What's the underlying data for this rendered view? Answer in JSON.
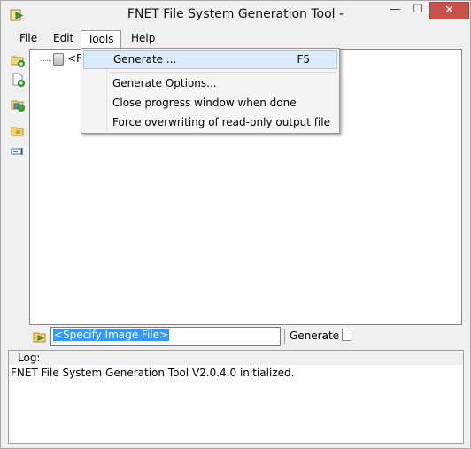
{
  "window": {
    "title": "FNET File System Generation Tool -",
    "minimize_glyph": "—",
    "maximize_glyph": "☐",
    "close_glyph": "✕"
  },
  "menubar": {
    "file": "File",
    "edit": "Edit",
    "tools": "Tools",
    "help": "Help"
  },
  "tools_menu": {
    "generate": "Generate ...",
    "generate_shortcut": "F5",
    "generate_options": "Generate Options...",
    "close_progress": "Close progress window when done",
    "force_overwrite": "Force overwriting of read-only output file"
  },
  "tree": {
    "root_label": "<F"
  },
  "image_bar": {
    "input_value": "<Specify Image File>",
    "generate_label": "Generate"
  },
  "log": {
    "label": "Log:",
    "message": "FNET File System Generation Tool V2.0.4.0 initialized."
  },
  "icons": {
    "app": "arrow-right-icon",
    "toolbar": [
      "add-folder-icon",
      "add-file-icon",
      "add-image-icon",
      "folder-properties-icon",
      "rename-icon"
    ]
  },
  "colors": {
    "close_button": "#c7504a",
    "menu_highlight": "#dcebfc",
    "selection": "#3399ff"
  }
}
